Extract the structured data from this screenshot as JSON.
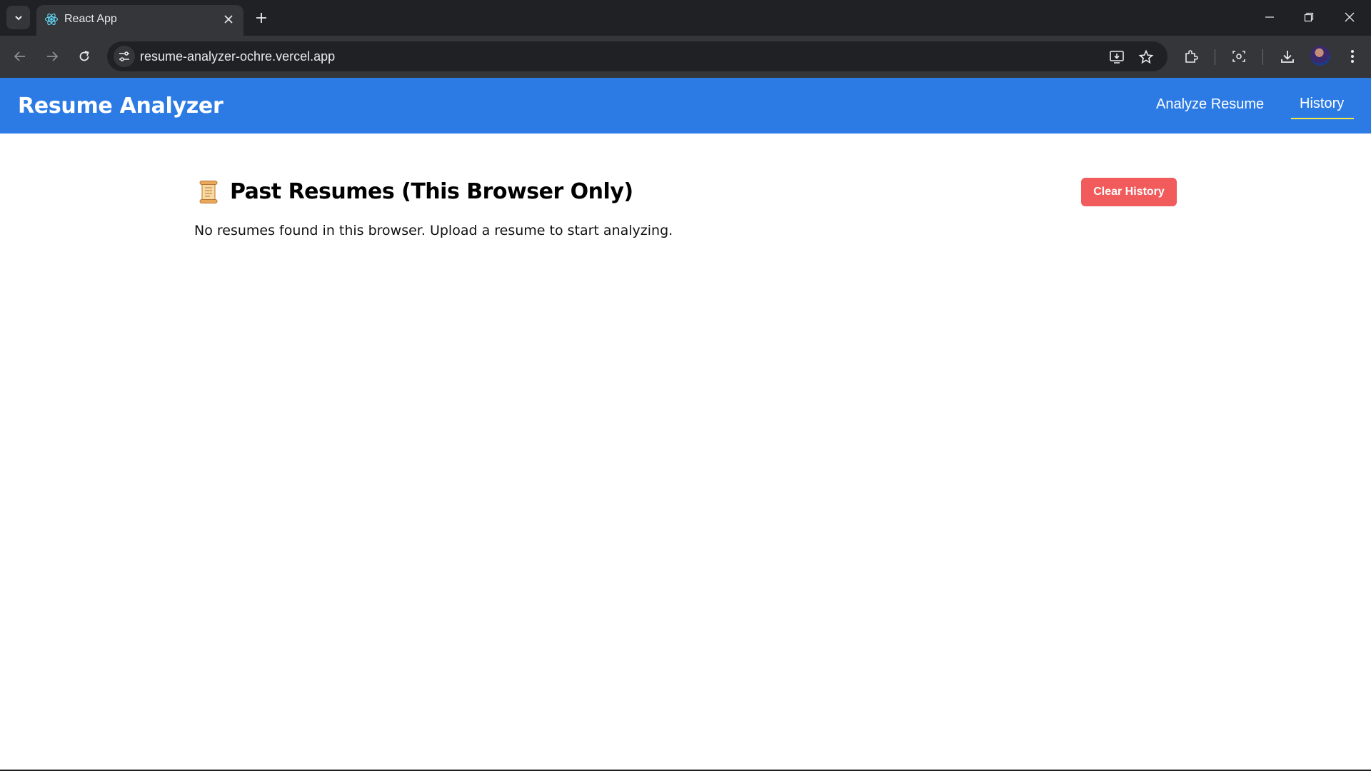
{
  "browser": {
    "tab_title": "React App",
    "url": "resume-analyzer-ochre.vercel.app"
  },
  "app": {
    "brand": "Resume Analyzer",
    "nav": [
      {
        "label": "Analyze Resume",
        "active": false
      },
      {
        "label": "History",
        "active": true
      }
    ],
    "accent_color": "#2c7be5",
    "active_underline_color": "#f5e642"
  },
  "history": {
    "title": "Past Resumes (This Browser Only)",
    "title_icon": "scroll-icon",
    "clear_button": "Clear History",
    "clear_button_color": "#f15b5b",
    "empty_message": "No resumes found in this browser. Upload a resume to start analyzing."
  }
}
